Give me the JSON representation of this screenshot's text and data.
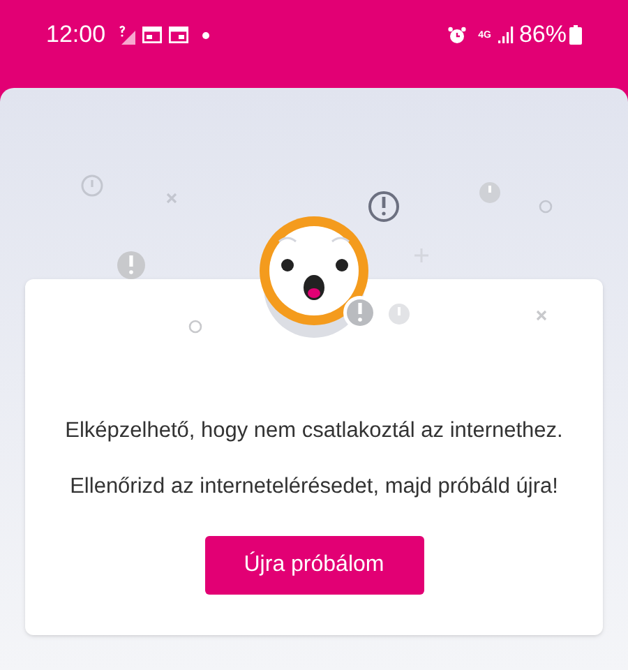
{
  "status_bar": {
    "time": "12:00",
    "network": "4G",
    "battery": "86%"
  },
  "message": {
    "lines": [
      "Elképzelhető, hogy nem csatlakoztál az internethez.",
      "Ellenőrizd az internetelérésedet, majd próbáld újra!"
    ]
  },
  "buttons": [
    {
      "label": "Újra próbálom"
    }
  ]
}
